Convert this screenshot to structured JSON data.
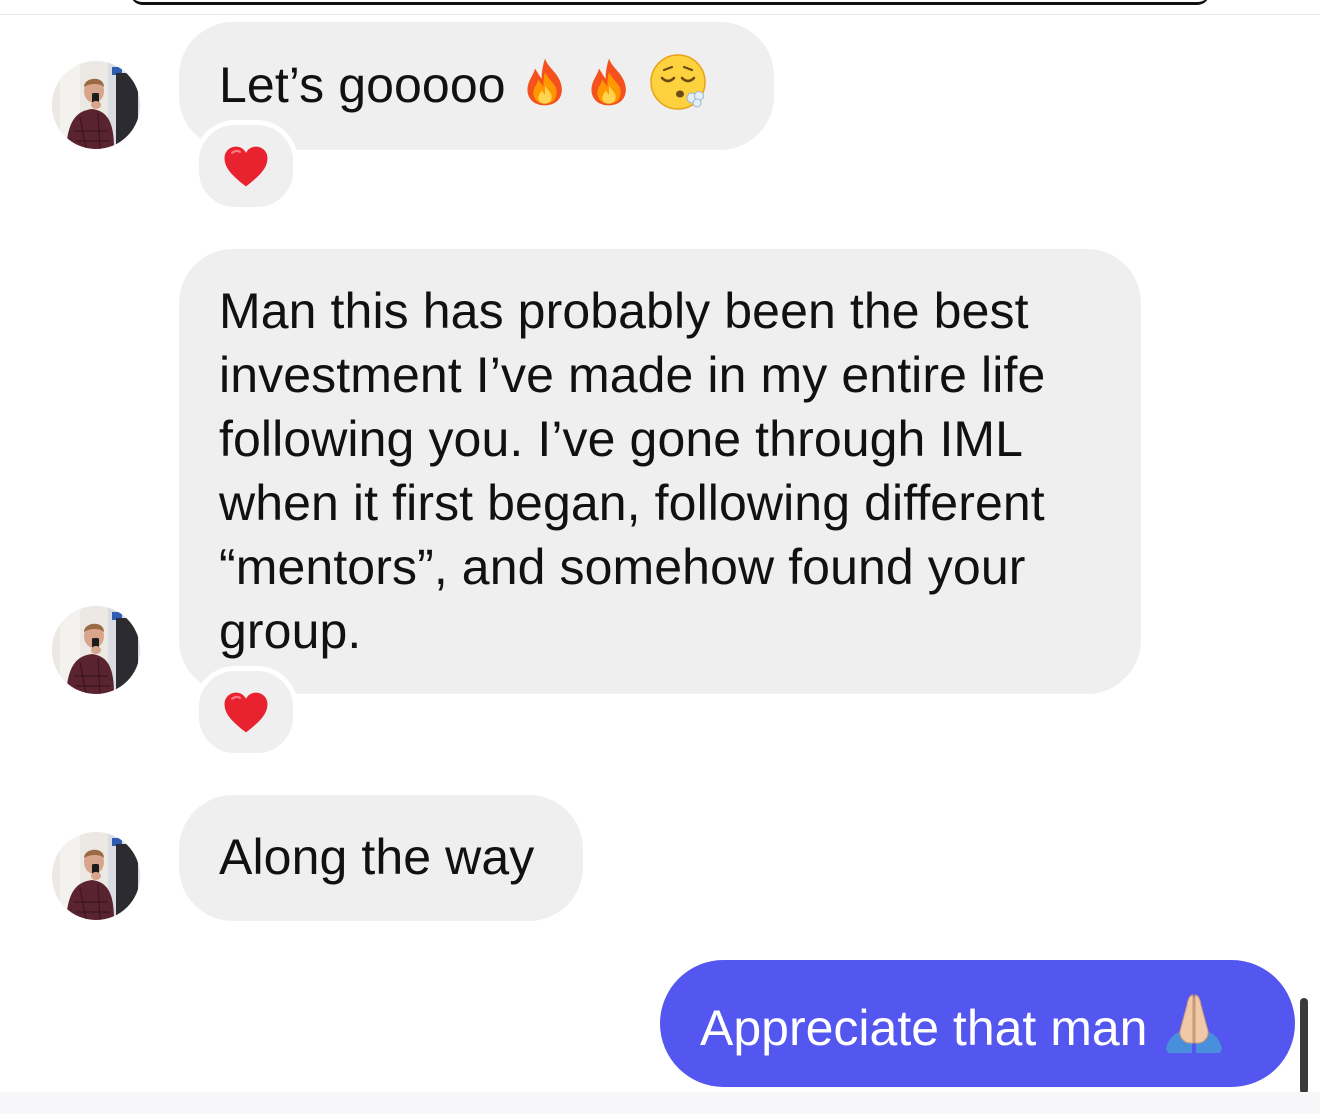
{
  "conversation": {
    "messages": [
      {
        "direction": "incoming",
        "lines": [
          "Let’s gooooo"
        ],
        "emojis": [
          "fire",
          "fire",
          "face-exhaling"
        ],
        "reaction": "red-heart"
      },
      {
        "direction": "incoming",
        "lines": [
          "Man this has probably been the best",
          "investment I’ve made in my entire life",
          "following you. I’ve gone through IML",
          "when it first began, following different",
          "“mentors”, and somehow found your",
          "group."
        ],
        "reaction": "red-heart"
      },
      {
        "direction": "incoming",
        "lines": [
          "Along the way"
        ]
      },
      {
        "direction": "outgoing",
        "lines": [
          "Appreciate that man"
        ],
        "emojis": [
          "folded-hands"
        ]
      }
    ]
  },
  "colors": {
    "incoming_bubble": "#efefef",
    "outgoing_bubble": "#5456f0",
    "reaction_heart": "#e8232f"
  }
}
